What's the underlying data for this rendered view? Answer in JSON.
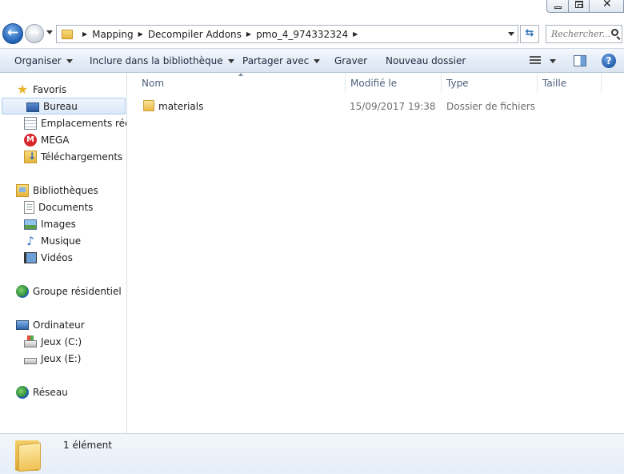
{
  "address": {
    "breadcrumbs": [
      "Mapping",
      "Decompiler Addons",
      "pmo_4_974332324"
    ],
    "search_placeholder": "Rechercher..."
  },
  "toolbar": {
    "organize": "Organiser",
    "include_library": "Inclure dans la bibliothèque",
    "share_with": "Partager avec",
    "burn": "Graver",
    "new_folder": "Nouveau dossier",
    "help": "?"
  },
  "nav": {
    "favorites": "Favoris",
    "desktop": "Bureau",
    "recent_places": "Emplacements récents",
    "mega": "MEGA",
    "downloads": "Téléchargements",
    "libraries": "Bibliothèques",
    "documents": "Documents",
    "images": "Images",
    "music": "Musique",
    "videos": "Vidéos",
    "homegroup": "Groupe résidentiel",
    "computer": "Ordinateur",
    "drive_c": "Jeux (C:)",
    "drive_e": "Jeux (E:)",
    "network": "Réseau"
  },
  "columns": {
    "name": "Nom",
    "modified": "Modifié le",
    "type": "Type",
    "size": "Taille"
  },
  "files": [
    {
      "name": "materials",
      "modified": "15/09/2017 19:38",
      "type": "Dossier de fichiers",
      "size": ""
    }
  ],
  "status": {
    "item_count": "1 élément"
  }
}
